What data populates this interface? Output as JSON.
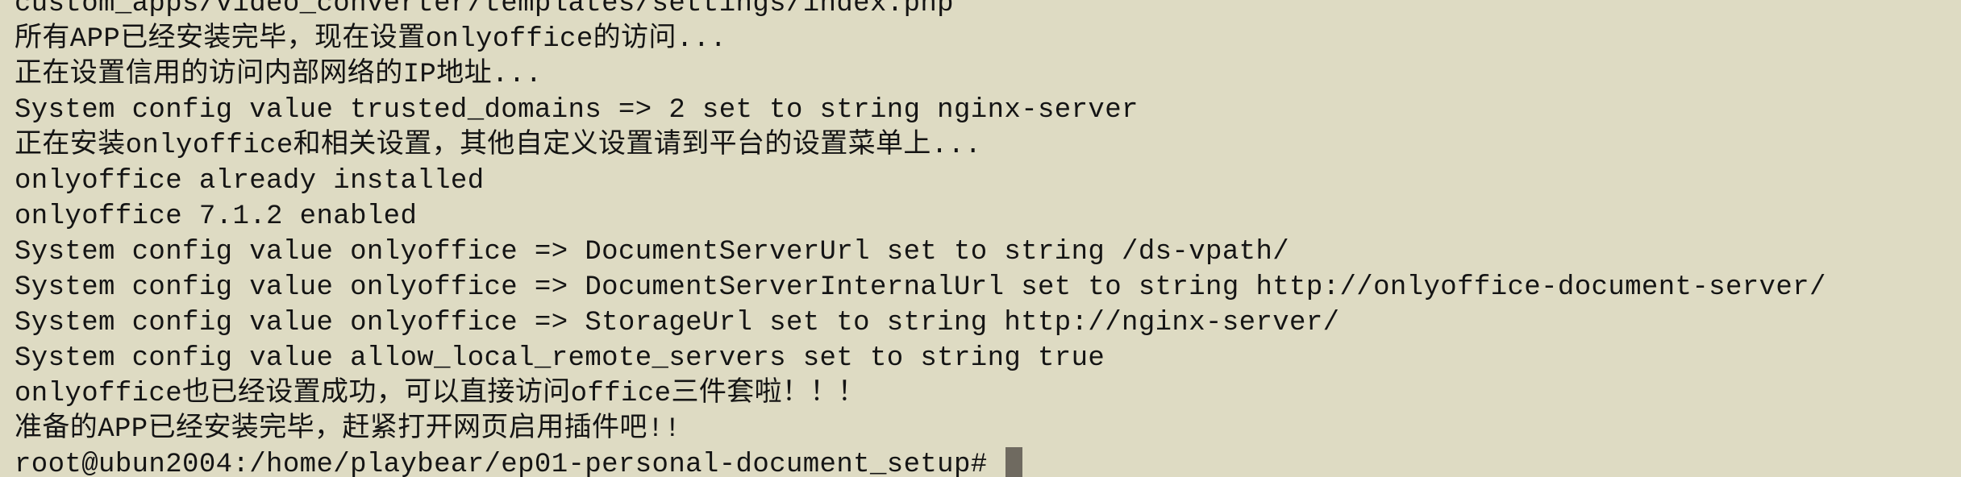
{
  "terminal": {
    "lines": [
      "custom_apps/video_converter/templates/settings/index.php",
      "所有APP已经安装完毕，现在设置onlyoffice的访问...",
      "正在设置信用的访问内部网络的IP地址...",
      "System config value trusted_domains => 2 set to string nginx-server",
      "正在安装onlyoffice和相关设置，其他自定义设置请到平台的设置菜单上...",
      "onlyoffice already installed",
      "onlyoffice 7.1.2 enabled",
      "System config value onlyoffice => DocumentServerUrl set to string /ds-vpath/",
      "System config value onlyoffice => DocumentServerInternalUrl set to string http://onlyoffice-document-server/",
      "System config value onlyoffice => StorageUrl set to string http://nginx-server/",
      "System config value allow_local_remote_servers set to string true",
      "onlyoffice也已经设置成功，可以直接访问office三件套啦！！！",
      "准备的APP已经安装完毕，赶紧打开网页启用插件吧!!"
    ],
    "prompt": "root@ubun2004:/home/playbear/ep01-personal-document_setup# "
  },
  "colors": {
    "background": "#dedbc3",
    "text": "#141414",
    "cursor": "#6f6a60"
  }
}
